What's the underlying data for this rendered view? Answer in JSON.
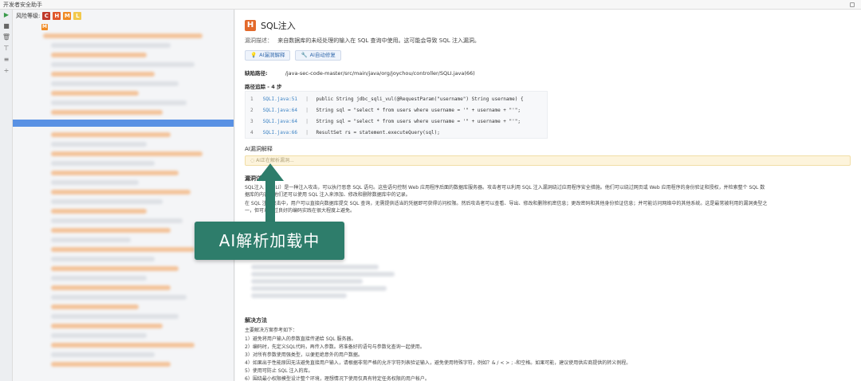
{
  "window": {
    "title": "开发者安全助手"
  },
  "toolbar": {
    "play_icon": "play-icon",
    "buttons": [
      "play-icon",
      "stop-icon",
      "delete-icon",
      "filter-icon",
      "expand-icon",
      "collapse-icon"
    ]
  },
  "risk": {
    "label": "风险等级:",
    "levels": [
      "C",
      "H",
      "M",
      "L"
    ]
  },
  "tree": {
    "root_badge": "M"
  },
  "vuln": {
    "badge": "H",
    "title": "SQL注入",
    "desc_label": "漏洞描述：",
    "desc_text": "来自数据库的未经处理的输入在 SQL 查询中使用。这可能会导致 SQL 注入漏洞。",
    "btn_explain": "AI漏洞解释",
    "btn_fix": "AI自动修复",
    "path_label": "缺陷路径:",
    "path_value": "/java-sec-code-master/src/main/java/org/joychou/controller/SQLI.java(66)",
    "trace_label": "路径追踪 - 4 步",
    "code": [
      {
        "n": "1",
        "file": "SQLI.java:51",
        "code": "public String jdbc_sqli_vul(@RequestParam(\"username\") String username) {"
      },
      {
        "n": "2",
        "file": "SQLI.java:64",
        "code": "String sql = \"select * from users where username = '\" + username + \"'\";"
      },
      {
        "n": "3",
        "file": "SQLI.java:64",
        "code": "String sql = \"select * from users where username = '\" + username + \"'\";"
      },
      {
        "n": "4",
        "file": "SQLI.java:66",
        "code": "ResultSet rs = statement.executeQuery(sql);"
      }
    ],
    "ai_label": "AI漏洞解释",
    "ai_loading": "AI正在解析漏洞...",
    "detail_label": "漏洞详情",
    "detail_p1": "SQL注入（SQLi）是一种注入攻击，可以执行恶意 SQL 语句。这些语句控制 Web 应用程序后面的数据库服务器。攻击者可以利用 SQL 注入漏洞绕过应用程序安全措施。他们可以绕过网页或 Web 应用程序的身份验证和授权，并检索整个 SQL 数",
    "detail_p2": "据库的内容。他们还可以使用 SQL 注入来添加、修改和删除数据库中的记录。",
    "detail_p3": "在 SQL 注入攻击中，用户可以直接向数据库提交 SQL 查询，无需提供适当的凭据即可获得访问权限。然后攻击者可以查看、导出、修改和删除机密信息；更改密码和其他身份验证信息；并可能访问网络中的其他系统。这是最常被利用的漏洞类型之",
    "detail_p4": "一，但可以通过良好的编码实践在很大程度上避免。",
    "solution_label": "解决方法",
    "solution_intro": "主要解决方案参考如下：",
    "solutions": [
      "1）避免将用户输入的参数直接传递给 SQL 服务器。",
      "2）编码时，先定义SQL代码，再传入参数。将准备好的语句与参数化查询一起使用。",
      "3）对所有参数使用强类型，以便拒绝意外的用户数据。",
      "4）如果出于性能原因无法避免直接用户输入，请根据非常严格的允许字符列表验证输入，避免使用特殊字符，例如？& / < > ; -和空格。如果可能，建议使用供应商提供的转义例程。",
      "5）使用可防止 SQL 注入的库。",
      "6）围绕最小权限模型设计整个环境，理想情况下使用仅具有特定任务权限的用户帐户。"
    ]
  },
  "overlay": {
    "banner": "AI解析加载中",
    "accent": "#2e7d6b"
  }
}
